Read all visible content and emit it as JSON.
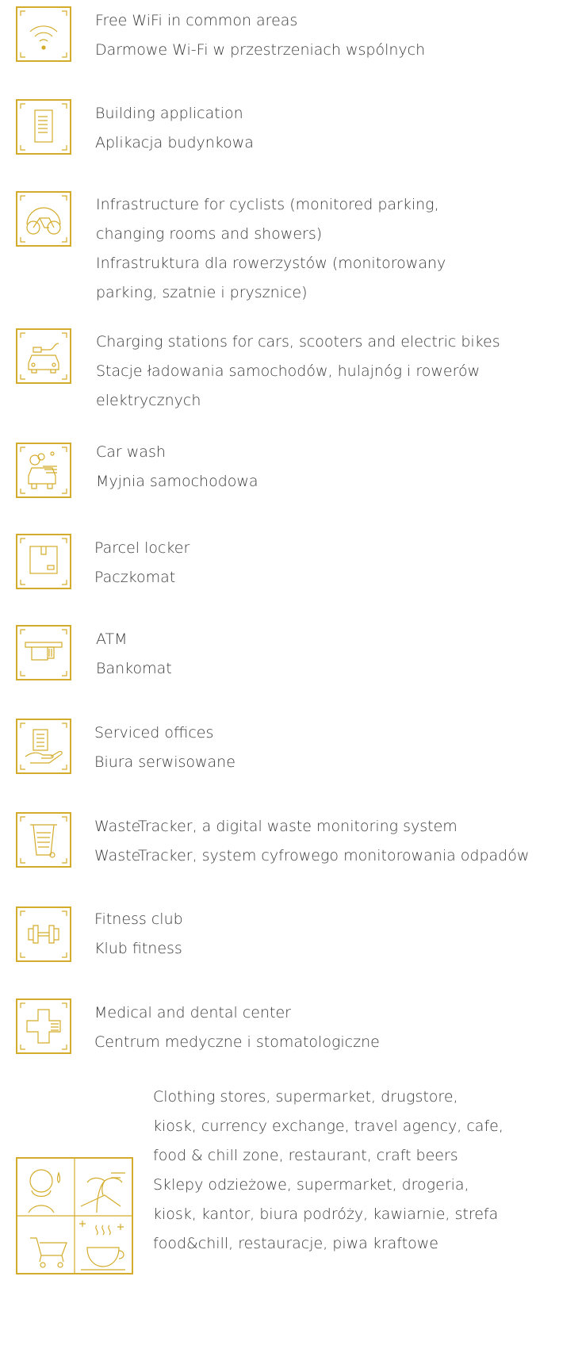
{
  "colors": {
    "accent": "#d4ac2b",
    "text": "#3b3b3b"
  },
  "amenities": [
    {
      "icon": "wifi-icon",
      "lines": [
        "Free WiFi in common areas",
        "Darmowe Wi-Fi w przestrzeniach wspólnych"
      ]
    },
    {
      "icon": "phone-app-icon",
      "lines": [
        "Building application",
        "Aplikacja budynkowa"
      ]
    },
    {
      "icon": "bicycle-icon",
      "lines": [
        "Infrastructure for cyclists (monitored parking,",
        "changing rooms and showers)",
        "Infrastruktura dla rowerzystów (monitorowany",
        "parking, szatnie i prysznice)"
      ]
    },
    {
      "icon": "ev-charging-icon",
      "lines": [
        "Charging stations for cars, scooters and electric bikes",
        "Stacje ładowania samochodów, hulajnóg i rowerów",
        "elektrycznych"
      ]
    },
    {
      "icon": "car-wash-icon",
      "lines": [
        "Car wash",
        "Myjnia samochodowa"
      ]
    },
    {
      "icon": "parcel-locker-icon",
      "lines": [
        "Parcel locker",
        "Paczkomat"
      ]
    },
    {
      "icon": "atm-icon",
      "lines": [
        "ATM",
        "Bankomat"
      ]
    },
    {
      "icon": "serviced-office-icon",
      "lines": [
        "Serviced offices",
        "Biura serwisowane"
      ]
    },
    {
      "icon": "waste-bin-icon",
      "lines": [
        "WasteTracker, a digital waste monitoring system",
        "WasteTracker, system cyfrowego monitorowania odpadów"
      ]
    },
    {
      "icon": "dumbbell-icon",
      "lines": [
        "Fitness club",
        "Klub fitness"
      ]
    },
    {
      "icon": "medical-cross-icon",
      "lines": [
        "Medical and dental center",
        "Centrum medyczne i stomatologiczne"
      ]
    }
  ],
  "retail": {
    "icon": "retail-collage-icon",
    "lines": [
      "Clothing stores, supermarket, drugstore,",
      "kiosk, currency exchange, travel agency, cafe,",
      "food & chill zone, restaurant, craft beers",
      "Sklepy odzieżowe, supermarket, drogeria,",
      "kiosk, kantor, biura podróży, kawiarnie, strefa",
      "food&chill, restauracje, piwa kraftowe"
    ]
  }
}
